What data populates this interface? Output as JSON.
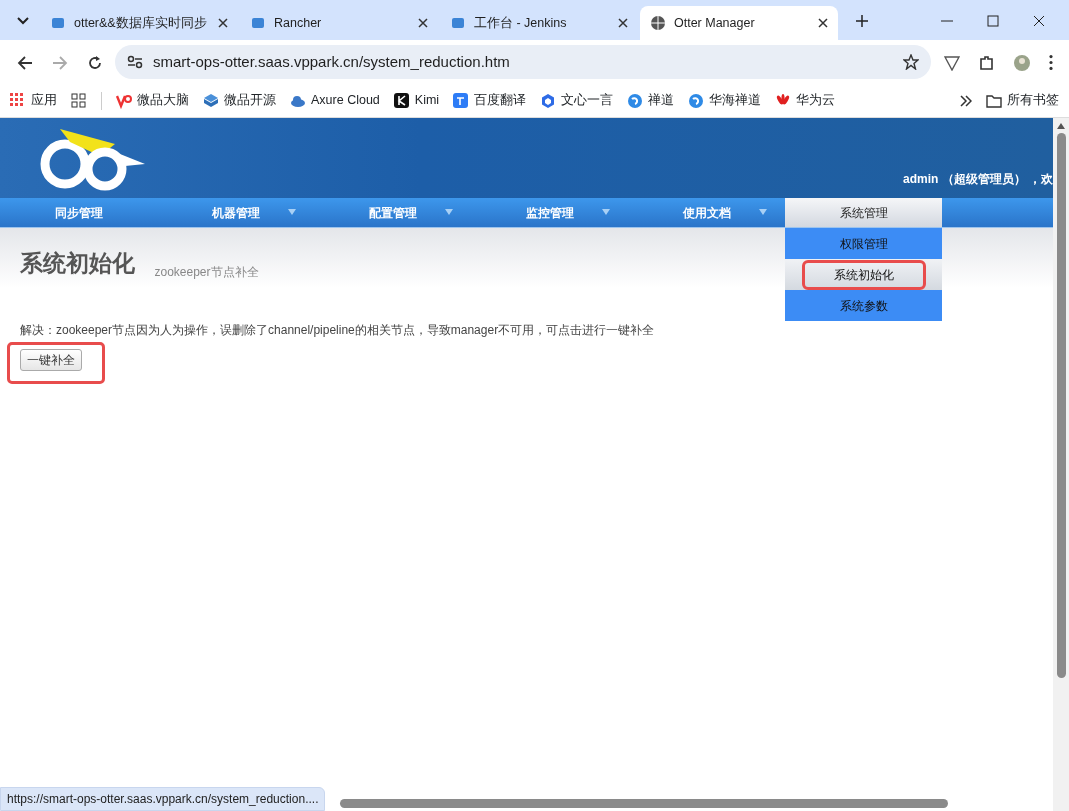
{
  "browser": {
    "tabs": [
      {
        "title": "otter&&数据库实时同步",
        "selected": false
      },
      {
        "title": "Rancher",
        "selected": false
      },
      {
        "title": "工作台 - Jenkins",
        "selected": false
      },
      {
        "title": "Otter Manager",
        "selected": true
      }
    ],
    "address": "smart-ops-otter.saas.vppark.cn/system_reduction.htm",
    "bookmarks": [
      {
        "label": "应用",
        "kind": "apps"
      },
      {
        "kind": "grid"
      },
      {
        "label": "微品大脑",
        "kind": "vp"
      },
      {
        "label": "微品开源",
        "kind": "cube"
      },
      {
        "label": "Axure Cloud",
        "kind": "cloud"
      },
      {
        "label": "Kimi",
        "kind": "k"
      },
      {
        "label": "百度翻译",
        "kind": "translate"
      },
      {
        "label": "文心一言",
        "kind": "hex"
      },
      {
        "label": "禅道",
        "kind": "swirl"
      },
      {
        "label": "华海禅道",
        "kind": "swirl"
      },
      {
        "label": "华为云",
        "kind": "flower"
      }
    ],
    "all_bookmarks": "所有书签",
    "status_url": "https://smart-ops-otter.saas.vppark.cn/system_reduction...."
  },
  "header": {
    "user": "admin （超级管理员） ，欢"
  },
  "nav": [
    {
      "label": "同步管理",
      "dropdown": false,
      "selected": false
    },
    {
      "label": "机器管理",
      "dropdown": true,
      "selected": false
    },
    {
      "label": "配置管理",
      "dropdown": true,
      "selected": false
    },
    {
      "label": "监控管理",
      "dropdown": true,
      "selected": false
    },
    {
      "label": "使用文档",
      "dropdown": true,
      "selected": false
    },
    {
      "label": "系统管理",
      "dropdown": false,
      "selected": true,
      "menu": [
        {
          "label": "权限管理",
          "selected": false,
          "highlighted": false
        },
        {
          "label": "系统初始化",
          "selected": true,
          "highlighted": true
        },
        {
          "label": "系统参数",
          "selected": false,
          "highlighted": false
        }
      ]
    }
  ],
  "page": {
    "title": "系统初始化",
    "subtitle": "zookeeper节点补全",
    "description": "解决：zookeeper节点因为人为操作，误删除了channel/pipeline的相关节点，导致manager不可用，可点击进行一键补全",
    "button": {
      "label": "一键补全",
      "highlighted": true
    }
  }
}
